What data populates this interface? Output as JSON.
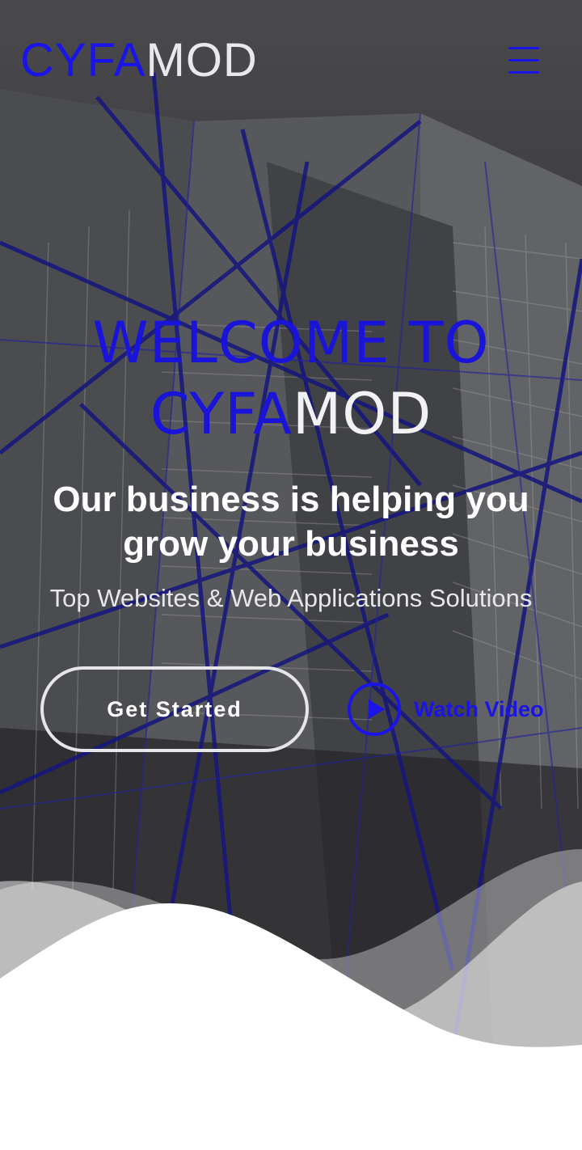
{
  "header": {
    "logo_accent": "CYFA",
    "logo_rest": "MOD",
    "menu_icon": "hamburger-menu-icon"
  },
  "hero": {
    "welcome_line1": "WELCOME TO",
    "welcome_accent": "CYFA",
    "welcome_rest": "MOD",
    "headline": "Our business is helping you grow your business",
    "subline": "Top Websites & Web Applications Solutions",
    "get_started_label": "Get Started",
    "watch_video_label": "Watch Video",
    "play_icon": "play-icon"
  },
  "colors": {
    "accent": "#1a14e6",
    "hero_bg": "#4b4b4f",
    "text_light": "#ffffff"
  }
}
